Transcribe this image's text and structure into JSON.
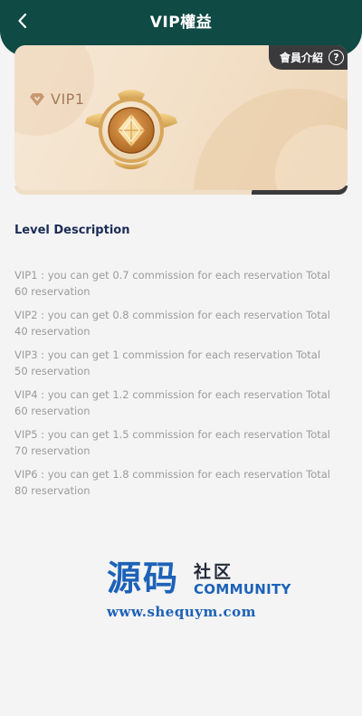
{
  "header": {
    "title": "VIP權益",
    "back_icon": "chevron-left-icon"
  },
  "vip_card": {
    "level": "VIP1",
    "member_intro_label": "會員介紹",
    "help_symbol": "?",
    "gem_icon": "diamond-icon",
    "medal_icon": "medal-badge-icon"
  },
  "level_description": {
    "title": "Level Description",
    "items": [
      "VIP1 : you can get 0.7 commission for each reservation Total 60 reservation",
      "VIP2 : you can get 0.8 commission for each reservation Total 40 reservation",
      "VIP3 : you can get 1 commission for each reservation Total 50 reservation",
      "VIP4 : you can get 1.2 commission for each reservation Total 60 reservation",
      "VIP5 : you can get 1.5 commission for each reservation Total 70 reservation",
      "VIP6 : you can get 1.8 commission for each reservation Total 80 reservation"
    ]
  },
  "watermark": {
    "main_text": "源码",
    "side_text": "社区",
    "community_text": "COMMUNITY",
    "url": "www.shequym.com"
  },
  "colors": {
    "header_bg": "#0f4a45",
    "accent_blue": "#1d62b8",
    "card_tag_bg": "#3a3a3d",
    "vip_text": "#a47b5a"
  }
}
